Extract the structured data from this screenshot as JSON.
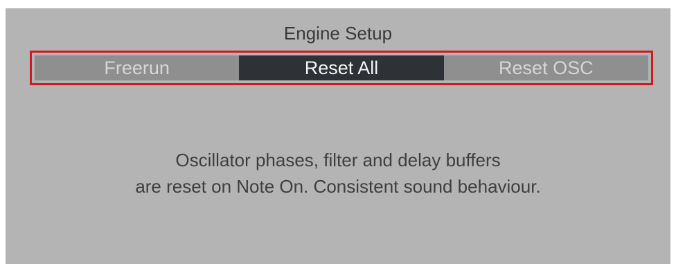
{
  "engine_setup": {
    "title": "Engine Setup",
    "options": [
      {
        "label": "Freerun",
        "selected": false
      },
      {
        "label": "Reset All",
        "selected": true
      },
      {
        "label": "Reset OSC",
        "selected": false
      }
    ],
    "description_line1": "Oscillator phases, filter and delay buffers",
    "description_line2": "are reset on Note On. Consistent sound behaviour."
  },
  "colors": {
    "panel_bg": "#b4b4b4",
    "segment_bg": "#8f8f8f",
    "segment_active_bg": "#2e3236",
    "highlight_border": "#d21a1a"
  }
}
